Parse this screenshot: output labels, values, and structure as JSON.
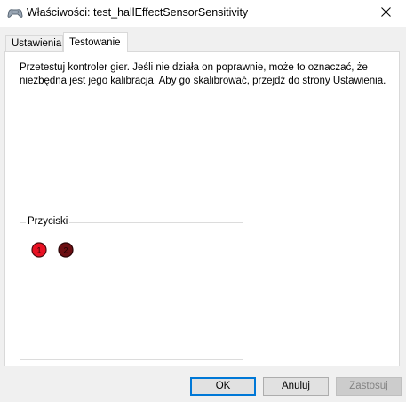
{
  "window": {
    "title": "Właściwości: test_hallEffectSensorSensitivity"
  },
  "tabs": [
    {
      "label": "Ustawienia",
      "active": false
    },
    {
      "label": "Testowanie",
      "active": true
    }
  ],
  "test_page": {
    "description": "Przetestuj kontroler gier. Jeśli nie działa on poprawnie, może to oznaczać, że niezbędna jest jego kalibracja. Aby go skalibrować, przejdź do strony Ustawienia.",
    "buttons_group": {
      "label": "Przyciski",
      "buttons": [
        {
          "number": "1",
          "pressed": true,
          "color": "#e81123"
        },
        {
          "number": "2",
          "pressed": false,
          "color": "#6b0e12"
        }
      ]
    }
  },
  "footer": {
    "ok_label": "OK",
    "cancel_label": "Anuluj",
    "apply_label": "Zastosuj",
    "apply_enabled": false
  },
  "colors": {
    "accent": "#0078d7",
    "button_pressed": "#e81123",
    "button_released": "#6b0e12"
  },
  "icons": {
    "title": "game-controller-icon",
    "close": "close-icon"
  }
}
